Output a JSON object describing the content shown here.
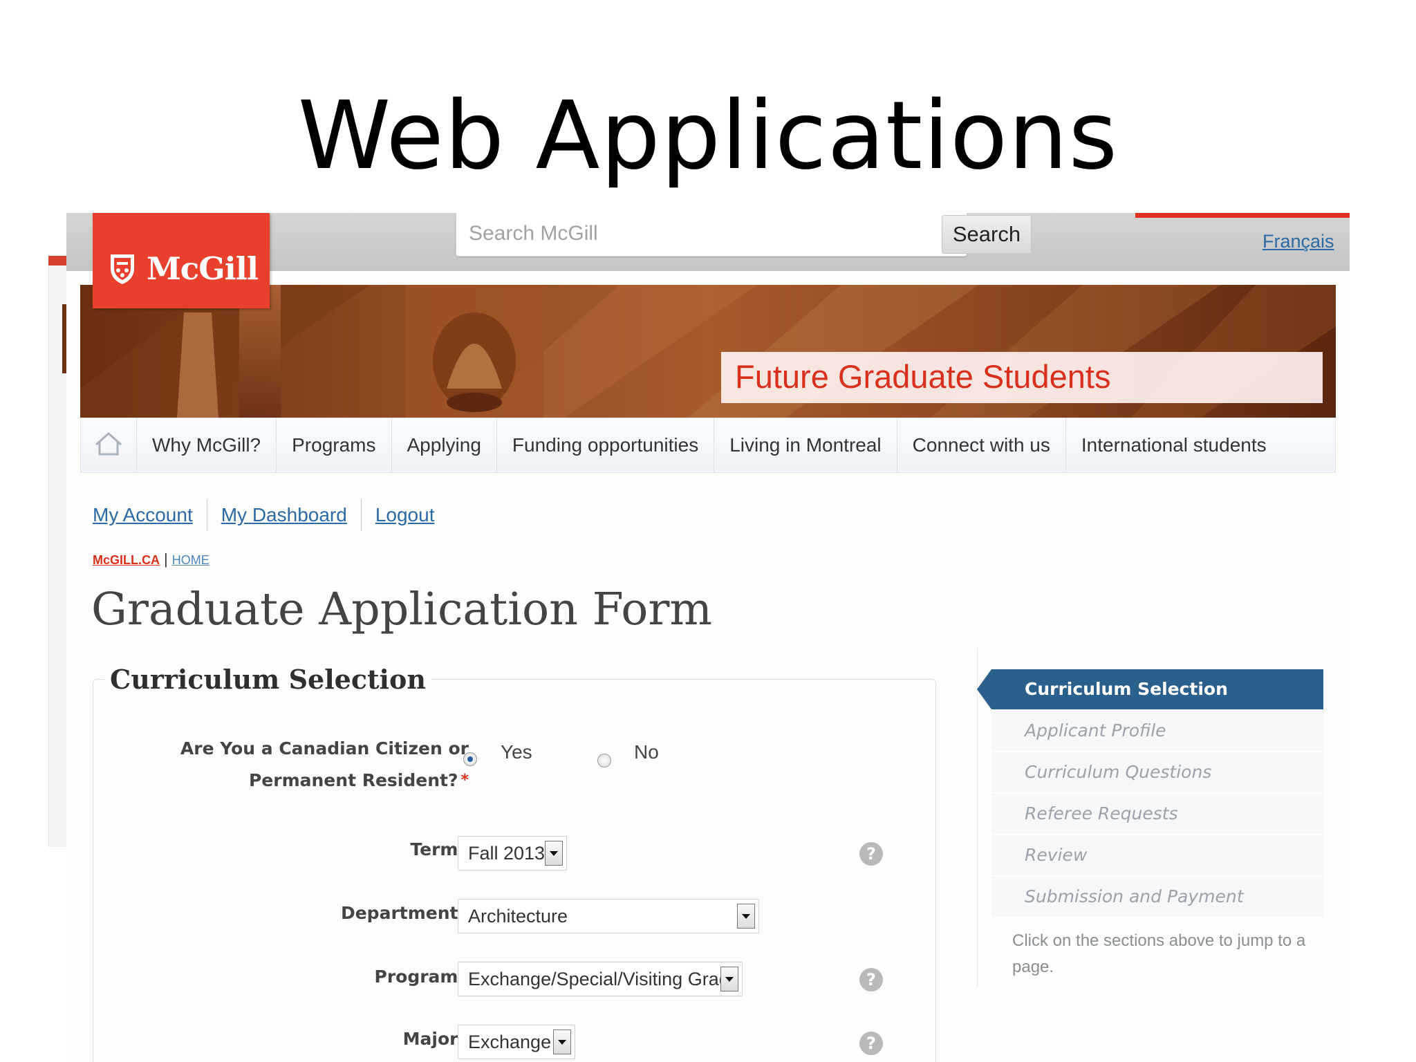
{
  "slide": {
    "title": "Web Applications"
  },
  "header": {
    "logo_text": "McGill",
    "search_placeholder": "Search McGill",
    "search_button": "Search",
    "language_link": "Français"
  },
  "banner": {
    "title": "Future Graduate Students"
  },
  "nav": {
    "items": [
      {
        "label": "Why McGill?"
      },
      {
        "label": "Programs"
      },
      {
        "label": "Applying"
      },
      {
        "label": "Funding opportunities"
      },
      {
        "label": "Living in Montreal"
      },
      {
        "label": "Connect with us"
      },
      {
        "label": "International students"
      }
    ]
  },
  "account": {
    "my_account": "My Account",
    "my_dashboard": "My Dashboard",
    "logout": "Logout"
  },
  "breadcrumb": {
    "site": "McGILL.CA",
    "home": "HOME"
  },
  "page": {
    "title": "Graduate Application Form"
  },
  "form": {
    "legend": "Curriculum Selection",
    "citizen": {
      "label_line1": "Are You a Canadian Citizen or",
      "label_line2": "Permanent Resident?",
      "required": "*",
      "options": [
        "Yes",
        "No"
      ],
      "selected": "Yes"
    },
    "term": {
      "label": "Term",
      "required": "*",
      "value": "Fall 2013"
    },
    "department": {
      "label": "Department",
      "required": "*",
      "value": "Architecture"
    },
    "program": {
      "label": "Program",
      "required": "*",
      "value": "Exchange/Special/Visiting Grad"
    },
    "major": {
      "label": "Major",
      "required": "*",
      "value": "Exchange"
    },
    "help_glyph": "?"
  },
  "sections": {
    "items": [
      {
        "label": "Curriculum Selection",
        "active": true
      },
      {
        "label": "Applicant Profile"
      },
      {
        "label": "Curriculum Questions"
      },
      {
        "label": "Referee Requests"
      },
      {
        "label": "Review"
      },
      {
        "label": "Submission and Payment"
      }
    ],
    "note": "Click on the sections above to jump to a page."
  },
  "colors": {
    "mcgill_red": "#e8402c",
    "link_blue": "#2b6aa5",
    "active_section": "#2b5f8c"
  }
}
